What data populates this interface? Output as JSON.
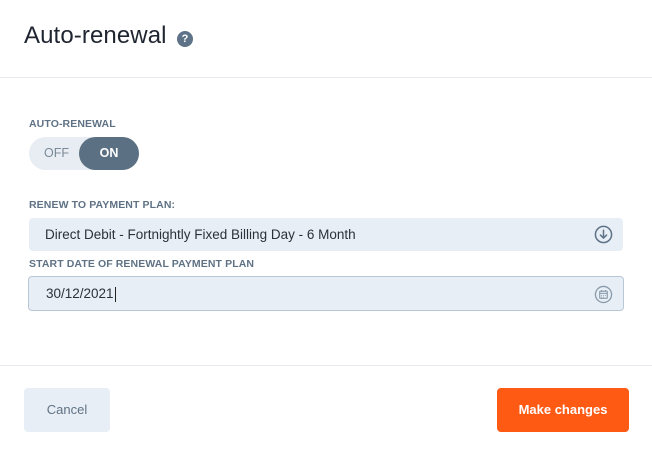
{
  "dialog": {
    "title": "Auto-renewal",
    "help_icon": "question-circle-icon",
    "help_glyph": "?"
  },
  "auto_renewal": {
    "label": "AUTO-RENEWAL",
    "off_label": "OFF",
    "on_label": "ON",
    "state": "on"
  },
  "payment_plan": {
    "label": "RENEW TO PAYMENT PLAN:",
    "value": "Direct Debit - Fortnightly Fixed Billing Day - 6 Month",
    "icon": "arrow-down-circle-icon"
  },
  "start_date": {
    "label": "START DATE OF RENEWAL PAYMENT PLAN",
    "value": "30/12/2021",
    "icon": "calendar-icon"
  },
  "footer": {
    "cancel_label": "Cancel",
    "submit_label": "Make changes"
  },
  "colors": {
    "primary": "#ff5a14",
    "toggle_on": "#5b7082",
    "field_bg": "#e8eef5",
    "label": "#5f7285"
  }
}
